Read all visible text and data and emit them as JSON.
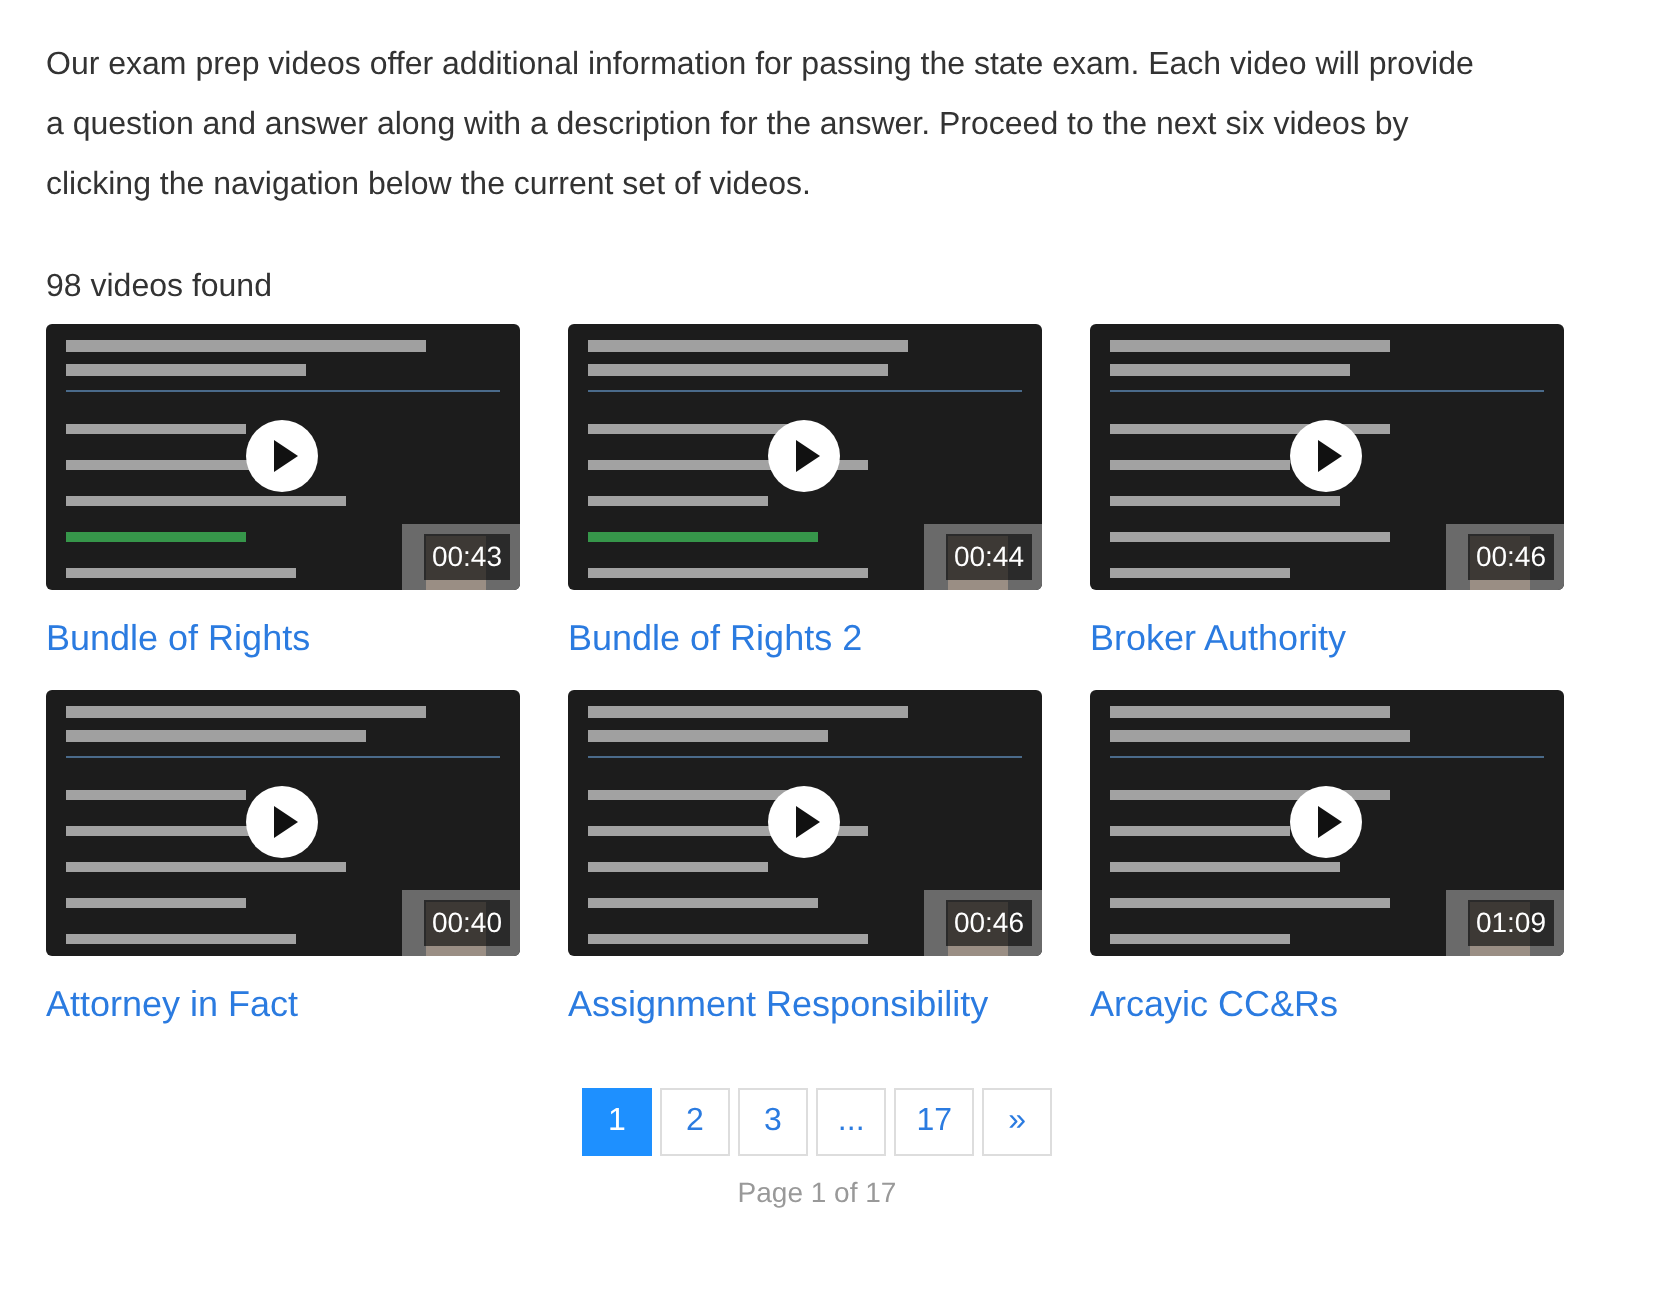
{
  "intro": "Our exam prep videos offer additional information for passing the state exam.  Each video will provide a question and answer along with a description for the answer.  Proceed to the next six videos by clicking the navigation below the current set of videos.",
  "count": "98 videos found",
  "videos": [
    {
      "title": "Bundle of Rights",
      "duration": "00:43"
    },
    {
      "title": "Bundle of Rights 2",
      "duration": "00:44"
    },
    {
      "title": "Broker Authority",
      "duration": "00:46"
    },
    {
      "title": "Attorney in Fact",
      "duration": "00:40"
    },
    {
      "title": "Assignment Responsibility",
      "duration": "00:46"
    },
    {
      "title": "Arcayic CC&Rs",
      "duration": "01:09"
    }
  ],
  "pagination": {
    "pages": [
      {
        "label": "1",
        "selected": true
      },
      {
        "label": "2",
        "selected": false
      },
      {
        "label": "3",
        "selected": false
      },
      {
        "label": "...",
        "selected": false
      },
      {
        "label": "17",
        "selected": false
      }
    ],
    "next": "»"
  },
  "status": "Page 1 of 17"
}
